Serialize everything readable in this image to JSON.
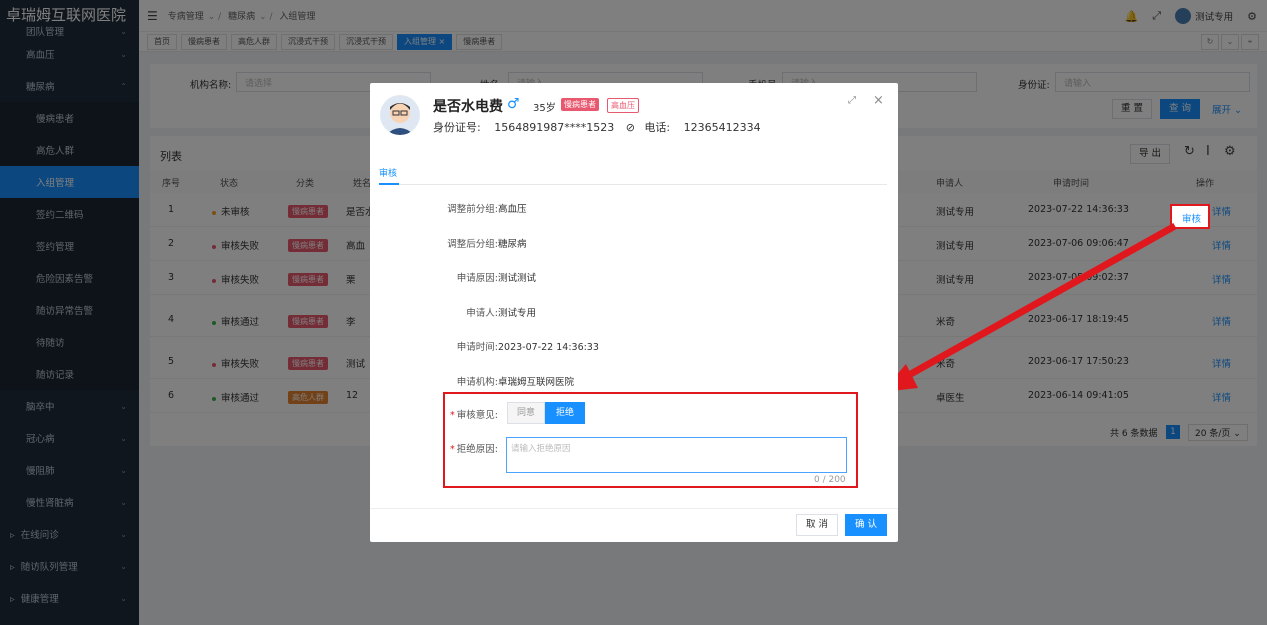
{
  "app": {
    "brand": "卓瑞姆互联网医院",
    "user": "测试专用"
  },
  "sidebar": {
    "items": [
      {
        "label": "团队管理",
        "type": "group"
      },
      {
        "label": "高血压",
        "type": "group"
      },
      {
        "label": "糖尿病",
        "type": "group-open"
      },
      {
        "label": "慢病患者",
        "type": "sub"
      },
      {
        "label": "高危人群",
        "type": "sub"
      },
      {
        "label": "入组管理",
        "type": "sub-active"
      },
      {
        "label": "签约二维码",
        "type": "sub"
      },
      {
        "label": "签约管理",
        "type": "sub"
      },
      {
        "label": "危险因素告警",
        "type": "sub"
      },
      {
        "label": "随访异常告警",
        "type": "sub"
      },
      {
        "label": "待随访",
        "type": "sub"
      },
      {
        "label": "随访记录",
        "type": "sub"
      },
      {
        "label": "脑卒中",
        "type": "group"
      },
      {
        "label": "冠心病",
        "type": "group"
      },
      {
        "label": "慢阻肺",
        "type": "group"
      },
      {
        "label": "慢性肾脏病",
        "type": "group"
      },
      {
        "label": "在线问诊",
        "type": "top"
      },
      {
        "label": "随访队列管理",
        "type": "top"
      },
      {
        "label": "健康管理",
        "type": "top"
      }
    ]
  },
  "breadcrumb": [
    "专病管理",
    "糖尿病",
    "入组管理"
  ],
  "tabs": [
    "首页",
    "慢病患者",
    "高危人群",
    "沉浸式干预",
    "沉浸式干预",
    "入组管理 ×",
    "慢病患者"
  ],
  "filter": {
    "org_label": "机构名称:",
    "org_placeholder": "请选择",
    "name_label": "姓名:",
    "name_placeholder": "请输入",
    "phone_label": "手机号:",
    "phone_placeholder": "请输入",
    "idcard_label": "身份证:",
    "idcard_placeholder": "请输入",
    "reset": "重 置",
    "search": "查 询",
    "expand": "展开 ⌄"
  },
  "table": {
    "title": "列表",
    "export": "导 出",
    "headers": [
      "序号",
      "状态",
      "分类",
      "姓名",
      "申请人",
      "申请时间",
      "操作"
    ],
    "rows": [
      {
        "no": "1",
        "status": "未审核",
        "status_color": "#f0a020",
        "cat": "慢病患者",
        "cat_color": "#e8586f",
        "name": "是否水",
        "applicant": "测试专用",
        "time": "2023-07-22 14:36:33",
        "a1": "审核",
        "a2": "详情"
      },
      {
        "no": "2",
        "status": "审核失败",
        "status_color": "#e8586f",
        "cat": "慢病患者",
        "cat_color": "#e8586f",
        "name": "高血",
        "applicant": "测试专用",
        "time": "2023-07-06 09:06:47",
        "a1": "",
        "a2": "详情"
      },
      {
        "no": "3",
        "status": "审核失败",
        "status_color": "#e8586f",
        "cat": "慢病患者",
        "cat_color": "#e8586f",
        "name": "栗",
        "applicant": "测试专用",
        "time": "2023-07-05 09:02:37",
        "a1": "",
        "a2": "详情"
      },
      {
        "no": "4",
        "status": "审核通过",
        "status_color": "#3bb54a",
        "cat": "慢病患者",
        "cat_color": "#e8586f",
        "name": "李",
        "applicant": "米奇",
        "time": "2023-06-17 18:19:45",
        "a1": "",
        "a2": "详情"
      },
      {
        "no": "5",
        "status": "审核失败",
        "status_color": "#e8586f",
        "cat": "慢病患者",
        "cat_color": "#e8586f",
        "name": "测试",
        "applicant": "米奇",
        "time": "2023-06-17 17:50:23",
        "a1": "",
        "a2": "详情"
      },
      {
        "no": "6",
        "status": "审核通过",
        "status_color": "#3bb54a",
        "cat": "高危人群",
        "cat_color": "#e6822f",
        "name": "12",
        "applicant": "卓医生",
        "time": "2023-06-14 09:41:05",
        "a1": "",
        "a2": "详情"
      }
    ],
    "total": "共 6 条数据",
    "page": "1",
    "pagesize": "20 条/页 ⌄"
  },
  "modal": {
    "name": "是否水电费",
    "gender": "♂",
    "age": "35岁",
    "tag1": "慢病患者",
    "tag2": "高血压",
    "id_label": "身份证号:",
    "id_value": "1564891987****1523",
    "phone_label": "电话:",
    "phone_value": "12365412334",
    "tab": "审核",
    "fields": [
      {
        "label": "调整前分组:",
        "value": "高血压"
      },
      {
        "label": "调整后分组:",
        "value": "糖尿病"
      },
      {
        "label": "申请原因:",
        "value": "测试测试"
      },
      {
        "label": "申请人:",
        "value": "测试专用"
      },
      {
        "label": "申请时间:",
        "value": "2023-07-22 14:36:33"
      },
      {
        "label": "申请机构:",
        "value": "卓瑞姆互联网医院"
      }
    ],
    "opinion_label": "审核意见:",
    "agree": "同意",
    "reject": "拒绝",
    "reason_label": "拒绝原因:",
    "reason_placeholder": "请输入拒绝原因",
    "counter": "0 / 200",
    "cancel": "取 消",
    "confirm": "确 认"
  },
  "colors": {
    "accent": "#1890ff",
    "sidebar": "#1f2d3d",
    "highlight": "#e0181d"
  }
}
